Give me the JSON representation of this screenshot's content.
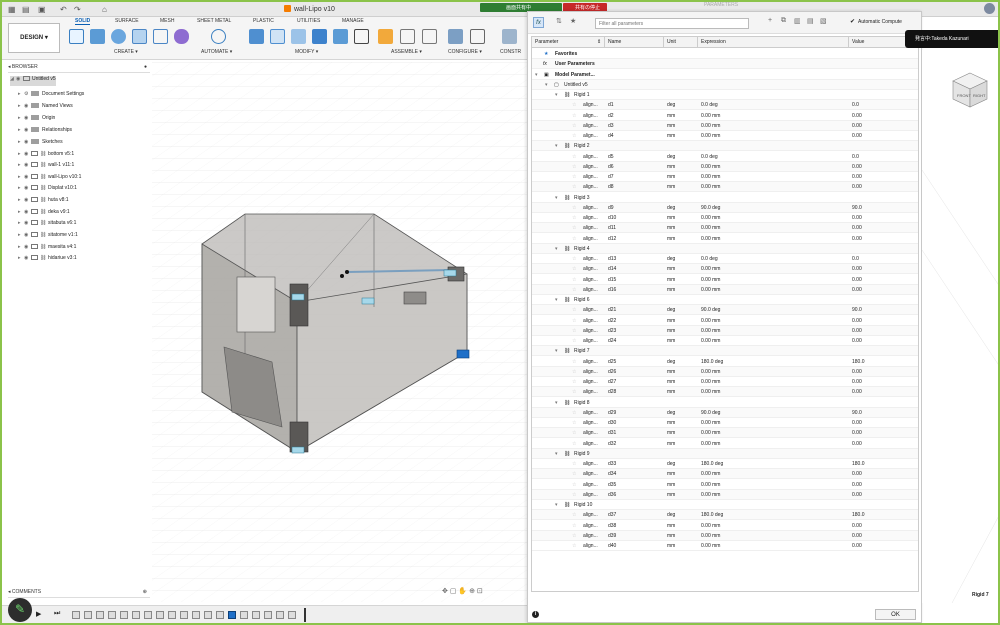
{
  "document_title": "wall-Lipo v10",
  "share": {
    "sharing_label": "画面共有中",
    "stop_label": "共有の停止"
  },
  "params_caption": "PARAMETERS",
  "presenter": "発言中:Takeda Kazunari",
  "toolbar": {
    "design_label": "DESIGN",
    "tabs": [
      "SOLID",
      "SURFACE",
      "MESH",
      "SHEET METAL",
      "PLASTIC",
      "UTILITIES",
      "MANAGE"
    ],
    "active_tab": "SOLID",
    "groups": [
      "CREATE",
      "AUTOMATE",
      "MODIFY",
      "ASSEMBLE",
      "CONFIGURE",
      "CONSTR"
    ]
  },
  "browser": {
    "title": "BROWSER",
    "items": [
      {
        "label": "Untitled v5"
      },
      {
        "label": "Document Settings"
      },
      {
        "label": "Named Views"
      },
      {
        "label": "Origin"
      },
      {
        "label": "Relationships"
      },
      {
        "label": "Sketches"
      },
      {
        "label": "bottom v5:1"
      },
      {
        "label": "wall-1 v11:1"
      },
      {
        "label": "wall-Lipo v10:1"
      },
      {
        "label": "Displat v10:1"
      },
      {
        "label": "huta v8:1"
      },
      {
        "label": "deka v9:1"
      },
      {
        "label": "sitabuta v6:1"
      },
      {
        "label": "sitatome v1:1"
      },
      {
        "label": "maesita v4:1"
      },
      {
        "label": "hidariue v3:1"
      }
    ]
  },
  "comments": {
    "title": "COMMENTS"
  },
  "dialog": {
    "filter_placeholder": "Filter all parameters",
    "auto_compute_label": "Automatic Compute",
    "auto_compute_checked": true,
    "columns": [
      "Parameter",
      "Name",
      "Unit",
      "Expression",
      "Value"
    ],
    "sections": [
      "Favorites",
      "User Parameters",
      "Model Paramet...",
      "Untitled v5"
    ],
    "groups": [
      {
        "name": "Rigid 1",
        "params": [
          {
            "param": "align...",
            "name": "d1",
            "unit": "deg",
            "expression": "0.0 deg",
            "value": "0.0"
          },
          {
            "param": "align...",
            "name": "d2",
            "unit": "mm",
            "expression": "0.00 mm",
            "value": "0.00"
          },
          {
            "param": "align...",
            "name": "d3",
            "unit": "mm",
            "expression": "0.00 mm",
            "value": "0.00"
          },
          {
            "param": "align...",
            "name": "d4",
            "unit": "mm",
            "expression": "0.00 mm",
            "value": "0.00"
          }
        ]
      },
      {
        "name": "Rigid 2",
        "params": [
          {
            "param": "align...",
            "name": "d5",
            "unit": "deg",
            "expression": "0.0 deg",
            "value": "0.0"
          },
          {
            "param": "align...",
            "name": "d6",
            "unit": "mm",
            "expression": "0.00 mm",
            "value": "0.00"
          },
          {
            "param": "align...",
            "name": "d7",
            "unit": "mm",
            "expression": "0.00 mm",
            "value": "0.00"
          },
          {
            "param": "align...",
            "name": "d8",
            "unit": "mm",
            "expression": "0.00 mm",
            "value": "0.00"
          }
        ]
      },
      {
        "name": "Rigid 3",
        "params": [
          {
            "param": "align...",
            "name": "d9",
            "unit": "deg",
            "expression": "90.0 deg",
            "value": "90.0"
          },
          {
            "param": "align...",
            "name": "d10",
            "unit": "mm",
            "expression": "0.00 mm",
            "value": "0.00"
          },
          {
            "param": "align...",
            "name": "d11",
            "unit": "mm",
            "expression": "0.00 mm",
            "value": "0.00"
          },
          {
            "param": "align...",
            "name": "d12",
            "unit": "mm",
            "expression": "0.00 mm",
            "value": "0.00"
          }
        ]
      },
      {
        "name": "Rigid 4",
        "params": [
          {
            "param": "align...",
            "name": "d13",
            "unit": "deg",
            "expression": "0.0 deg",
            "value": "0.0"
          },
          {
            "param": "align...",
            "name": "d14",
            "unit": "mm",
            "expression": "0.00 mm",
            "value": "0.00"
          },
          {
            "param": "align...",
            "name": "d15",
            "unit": "mm",
            "expression": "0.00 mm",
            "value": "0.00"
          },
          {
            "param": "align...",
            "name": "d16",
            "unit": "mm",
            "expression": "0.00 mm",
            "value": "0.00"
          }
        ]
      },
      {
        "name": "Rigid 6",
        "params": [
          {
            "param": "align...",
            "name": "d21",
            "unit": "deg",
            "expression": "90.0 deg",
            "value": "90.0"
          },
          {
            "param": "align...",
            "name": "d22",
            "unit": "mm",
            "expression": "0.00 mm",
            "value": "0.00"
          },
          {
            "param": "align...",
            "name": "d23",
            "unit": "mm",
            "expression": "0.00 mm",
            "value": "0.00"
          },
          {
            "param": "align...",
            "name": "d24",
            "unit": "mm",
            "expression": "0.00 mm",
            "value": "0.00"
          }
        ]
      },
      {
        "name": "Rigid 7",
        "params": [
          {
            "param": "align...",
            "name": "d25",
            "unit": "deg",
            "expression": "180.0 deg",
            "value": "180.0"
          },
          {
            "param": "align...",
            "name": "d26",
            "unit": "mm",
            "expression": "0.00 mm",
            "value": "0.00"
          },
          {
            "param": "align...",
            "name": "d27",
            "unit": "mm",
            "expression": "0.00 mm",
            "value": "0.00"
          },
          {
            "param": "align...",
            "name": "d28",
            "unit": "mm",
            "expression": "0.00 mm",
            "value": "0.00"
          }
        ]
      },
      {
        "name": "Rigid 8",
        "params": [
          {
            "param": "align...",
            "name": "d29",
            "unit": "deg",
            "expression": "90.0 deg",
            "value": "90.0"
          },
          {
            "param": "align...",
            "name": "d30",
            "unit": "mm",
            "expression": "0.00 mm",
            "value": "0.00"
          },
          {
            "param": "align...",
            "name": "d31",
            "unit": "mm",
            "expression": "0.00 mm",
            "value": "0.00"
          },
          {
            "param": "align...",
            "name": "d32",
            "unit": "mm",
            "expression": "0.00 mm",
            "value": "0.00"
          }
        ]
      },
      {
        "name": "Rigid 9",
        "params": [
          {
            "param": "align...",
            "name": "d33",
            "unit": "deg",
            "expression": "180.0 deg",
            "value": "180.0"
          },
          {
            "param": "align...",
            "name": "d34",
            "unit": "mm",
            "expression": "0.00 mm",
            "value": "0.00"
          },
          {
            "param": "align...",
            "name": "d35",
            "unit": "mm",
            "expression": "0.00 mm",
            "value": "0.00"
          },
          {
            "param": "align...",
            "name": "d36",
            "unit": "mm",
            "expression": "0.00 mm",
            "value": "0.00"
          }
        ]
      },
      {
        "name": "Rigid 10",
        "params": [
          {
            "param": "align...",
            "name": "d37",
            "unit": "deg",
            "expression": "180.0 deg",
            "value": "180.0"
          },
          {
            "param": "align...",
            "name": "d38",
            "unit": "mm",
            "expression": "0.00 mm",
            "value": "0.00"
          },
          {
            "param": "align...",
            "name": "d39",
            "unit": "mm",
            "expression": "0.00 mm",
            "value": "0.00"
          },
          {
            "param": "align...",
            "name": "d40",
            "unit": "mm",
            "expression": "0.00 mm",
            "value": "0.00"
          }
        ]
      }
    ],
    "ok_label": "OK"
  },
  "viewcube_labels": [
    "FRONT",
    "RIGHT"
  ],
  "selection_label": "Rigid 7",
  "colors": {
    "accent": "#0a5fb4",
    "share_green": "#2e7d32",
    "share_red": "#c62828",
    "frame_green": "#8bc34a"
  }
}
